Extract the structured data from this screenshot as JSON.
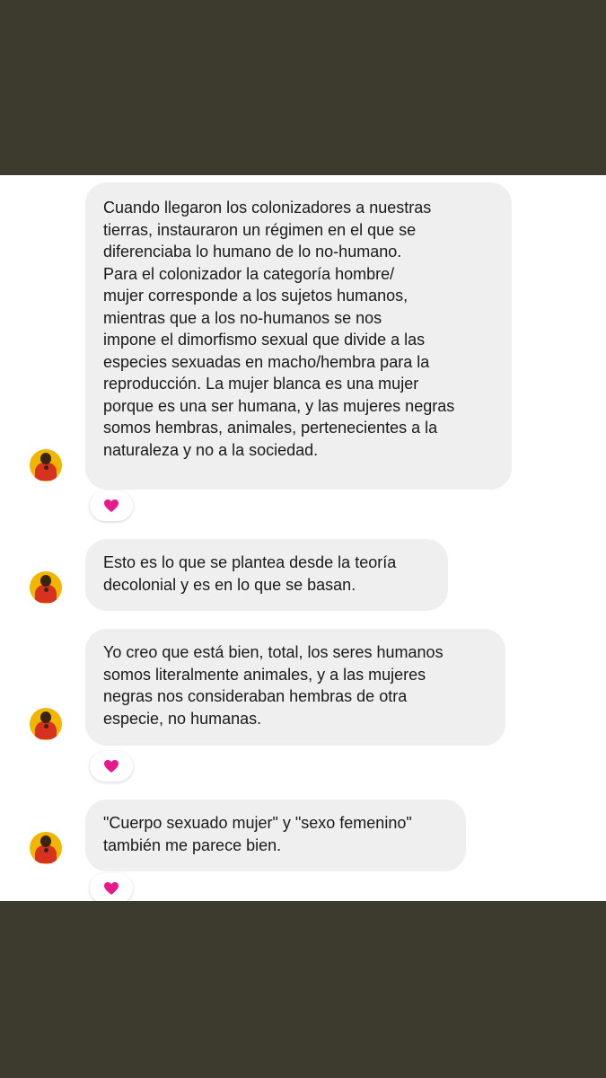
{
  "messages": [
    {
      "lines": [
        "Cuando llegaron los colonizadores a nuestras",
        "tierras, instauraron un régimen en el que se",
        "diferenciaba lo humano de lo no-humano.",
        "Para el colonizador la categoría hombre/",
        "mujer corresponde a los sujetos humanos,",
        "mientras que a los no-humanos se nos",
        "impone el dimorfismo sexual que divide a las",
        "especies sexuadas en macho/hembra para la",
        "reproducción. La mujer blanca es una mujer",
        "porque es una ser humana, y las mujeres negras",
        "somos hembras, animales, pertenecientes a la",
        "naturaleza y no a la sociedad."
      ],
      "reaction": "heart"
    },
    {
      "lines": [
        "Esto es lo que se plantea desde la teoría",
        "decolonial y es en lo que se basan."
      ]
    },
    {
      "lines": [
        "Yo creo que está bien, total, los seres humanos",
        "somos literalmente animales, y a las mujeres",
        "negras nos consideraban hembras de otra",
        "especie, no humanas."
      ],
      "reaction": "heart"
    },
    {
      "lines": [
        "\"Cuerpo sexuado mujer\" y \"sexo femenino\"",
        "también me parece bien."
      ],
      "reaction": "heart"
    }
  ],
  "colors": {
    "background": "#3d3a2e",
    "bubble": "#efefef",
    "heart": "#e8198b",
    "avatar_bg": "#f2b500"
  }
}
